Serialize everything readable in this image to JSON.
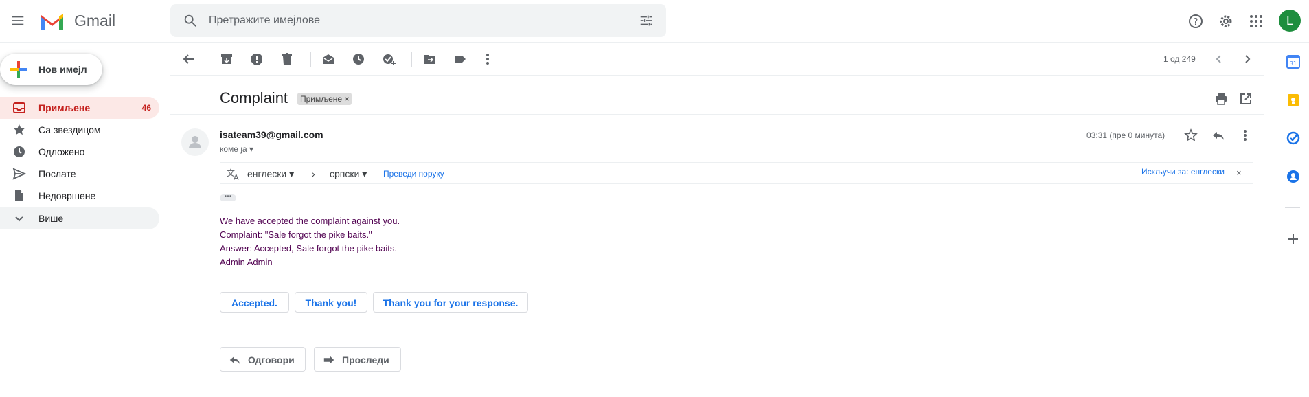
{
  "app": {
    "brand": "Gmail",
    "account_initial": "L"
  },
  "search": {
    "placeholder": "Претражите имејлове"
  },
  "compose": {
    "label": "Нов имејл"
  },
  "sidebar": {
    "items": [
      {
        "label": "Примљене",
        "count": "46",
        "icon": "inbox-icon"
      },
      {
        "label": "Са звездицом",
        "icon": "star-icon"
      },
      {
        "label": "Одложено",
        "icon": "clock-icon"
      },
      {
        "label": "Послате",
        "icon": "send-icon"
      },
      {
        "label": "Недовршене",
        "icon": "draft-icon"
      },
      {
        "label": "Више",
        "icon": "chevron-down-icon"
      }
    ]
  },
  "toolbar": {
    "pager": "1 од 249"
  },
  "email": {
    "subject": "Complaint",
    "label_chip": "Примљене",
    "sender": "isateam39@gmail.com",
    "to": "коме ја",
    "time": "03:31 (пре 0 минута)",
    "body": [
      "We have accepted the complaint against you.",
      "Complaint: \"Sale forgot the pike baits.\"",
      "Answer: Accepted, Sale forgot the pike baits.",
      "Admin Admin"
    ]
  },
  "translate": {
    "from": "енглески",
    "to": "српски",
    "translate_link": "Преведи поруку",
    "disable_link": "Искључи за: енглески"
  },
  "smart_replies": [
    "Accepted.",
    "Thank you!",
    "Thank you for your response."
  ],
  "actions": {
    "reply": "Одговори",
    "forward": "Проследи"
  },
  "colors": {
    "accent_red": "#c5221f",
    "link_blue": "#1a73e8",
    "avatar_green": "#1e8e3e"
  }
}
